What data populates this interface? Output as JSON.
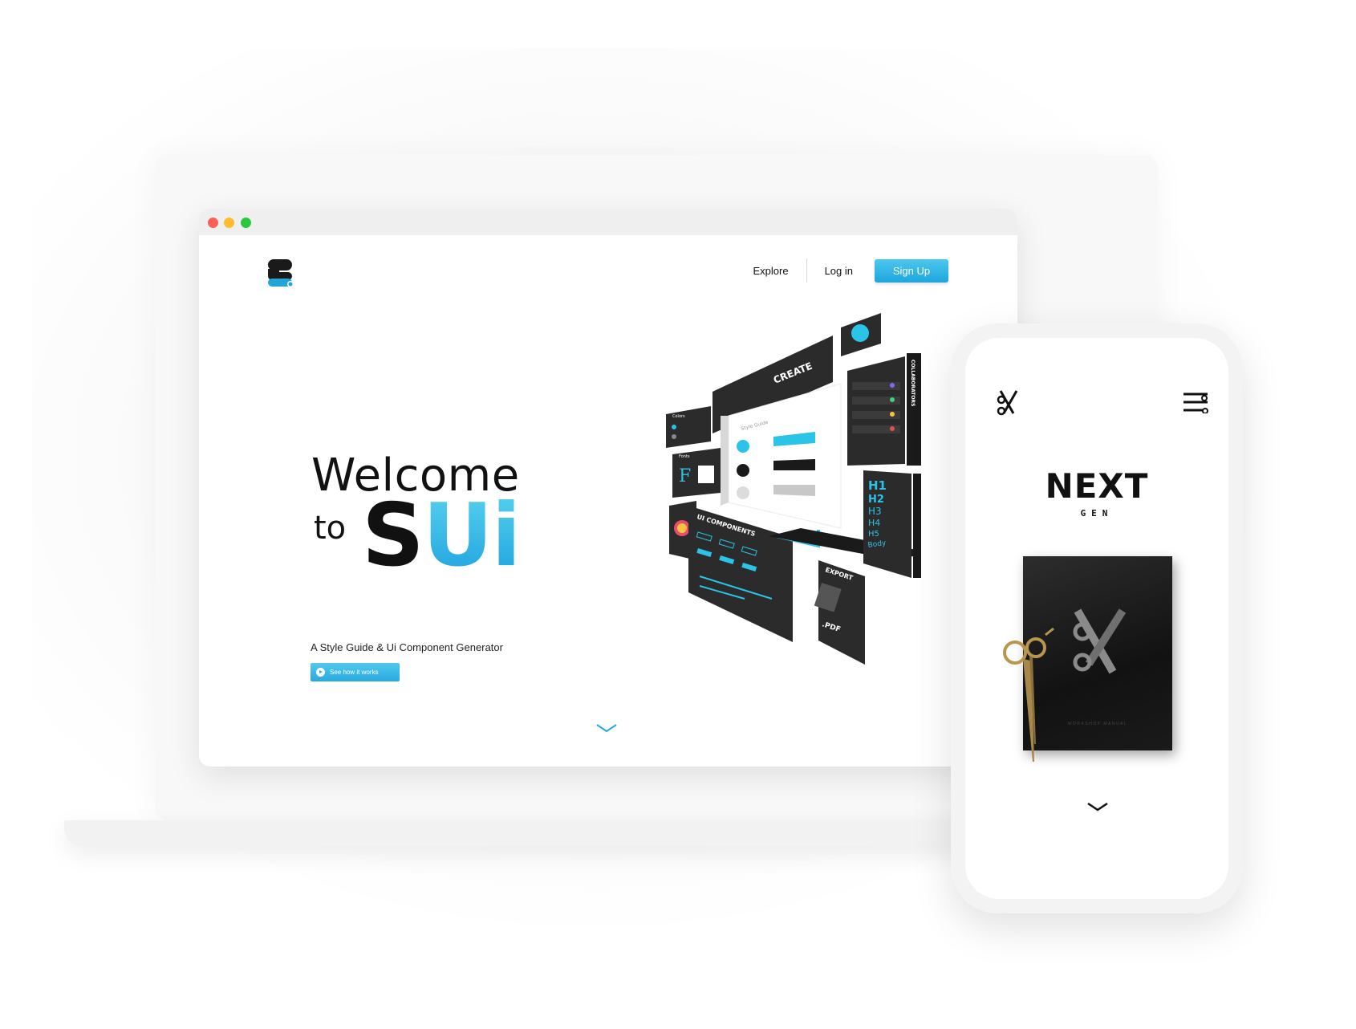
{
  "browser": {
    "nav": {
      "explore": "Explore",
      "login": "Log in",
      "signup": "Sign Up"
    },
    "hero": {
      "welcome": "Welcome",
      "to": "to",
      "brand_s": "S",
      "brand_ui": "Ui",
      "tagline": "A Style Guide & Ui Component Generator",
      "cta": "See how it works"
    },
    "illustration": {
      "create": "CREATE",
      "collaborators": "COLLABORATORS",
      "style_guide": "Style Guide",
      "colors": "Colors",
      "fonts": "Fonts",
      "ui_components": "UI COMPONENTS",
      "export": "EXPORT",
      "pdf": ".PDF",
      "headings": [
        "H1",
        "H2",
        "H3",
        "H4",
        "H5",
        "Body"
      ]
    }
  },
  "phone": {
    "title": "NEXT",
    "subtitle": "GEN",
    "book_caption": "WORKSHOP MANUAL"
  },
  "colors": {
    "accent": "#27a9df",
    "dark": "#111111"
  }
}
